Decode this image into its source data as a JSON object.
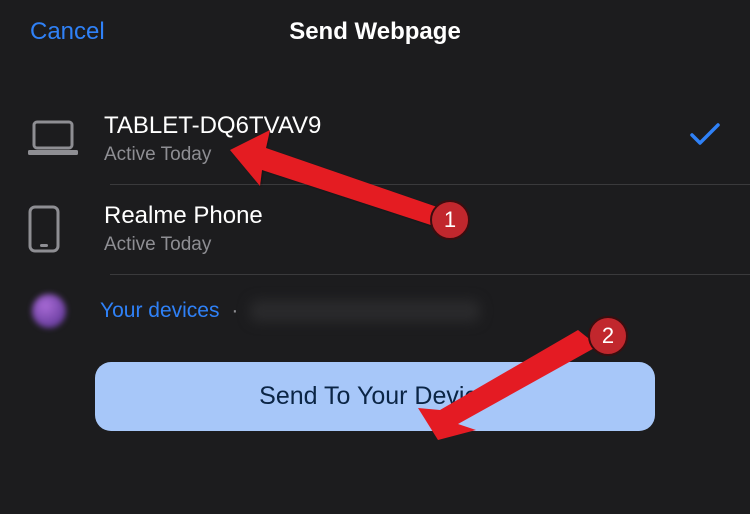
{
  "header": {
    "cancel_label": "Cancel",
    "title": "Send Webpage"
  },
  "devices": [
    {
      "name": "TABLET-DQ6TVAV9",
      "status": "Active Today",
      "selected": true,
      "icon": "laptop"
    },
    {
      "name": "Realme Phone",
      "status": "Active Today",
      "selected": false,
      "icon": "phone"
    }
  ],
  "footer": {
    "your_devices_label": "Your devices",
    "separator": "·"
  },
  "send_button_label": "Send To Your Device",
  "annotations": {
    "badge1": "1",
    "badge2": "2"
  }
}
